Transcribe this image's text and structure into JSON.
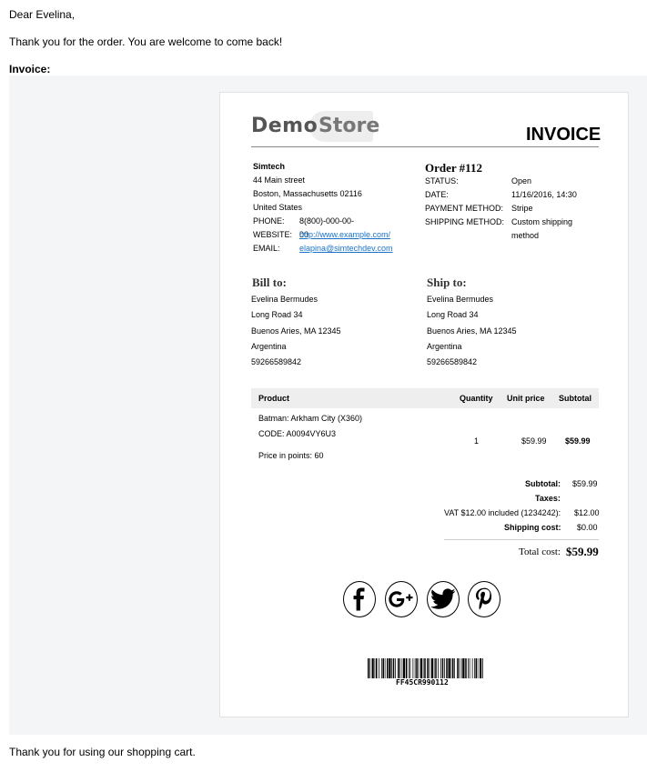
{
  "email": {
    "greeting": "Dear Evelina,",
    "thanks": "Thank you for the order. You are welcome to come back!",
    "invoice_label": "Invoice:",
    "footer": "Thank you for using our shopping cart."
  },
  "logo": {
    "part1": "Demo",
    "part2": "Store"
  },
  "invoice_title": "INVOICE",
  "company": {
    "name": "Simtech",
    "street": "44 Main street",
    "city": "Boston, Massachusetts 02116",
    "country": "United States",
    "phone_label": "PHONE:",
    "phone": "8(800)-000-00-00",
    "website_label": "WEBSITE:",
    "website": "http://www.example.com/",
    "email_label": "EMAIL:",
    "email": "elapina@simtechdev.com"
  },
  "order": {
    "title": "Order #112",
    "status_label": "STATUS:",
    "status": "Open",
    "date_label": "DATE:",
    "date": "11/16/2016, 14:30",
    "payment_label": "PAYMENT METHOD:",
    "payment": "Stripe",
    "shipping_label": "SHIPPING METHOD:",
    "shipping_line1": "Custom shipping",
    "shipping_line2": "method"
  },
  "bill_to": {
    "title": "Bill to:",
    "name": "Evelina Bermudes",
    "street": "Long Road 34",
    "city": "Buenos Aries, MA 12345",
    "country": "Argentina",
    "phone": "59266589842"
  },
  "ship_to": {
    "title": "Ship to:",
    "name": "Evelina Bermudes",
    "street": "Long Road 34",
    "city": "Buenos Aries, MA 12345",
    "country": "Argentina",
    "phone": "59266589842"
  },
  "table": {
    "headers": {
      "product": "Product",
      "quantity": "Quantity",
      "unit_price": "Unit price",
      "subtotal": "Subtotal"
    },
    "item": {
      "name": "Batman: Arkham City (X360)",
      "code": "CODE: A0094VY6U3",
      "points": "Price in points: 60",
      "quantity": "1",
      "unit_price": "$59.99",
      "subtotal": "$59.99"
    }
  },
  "totals": {
    "subtotal_label": "Subtotal:",
    "subtotal": "$59.99",
    "taxes_label": "Taxes:",
    "vat_label": "VAT $12.00 included (1234242):",
    "vat": "$12.00",
    "shipping_label": "Shipping cost:",
    "shipping": "$0.00",
    "total_label": "Total cost:",
    "total": "$59.99"
  },
  "social": {
    "facebook": "facebook-icon",
    "google_plus": "google-plus-icon",
    "twitter": "twitter-icon",
    "pinterest": "pinterest-icon"
  },
  "barcode_text": "FF45CR990112"
}
